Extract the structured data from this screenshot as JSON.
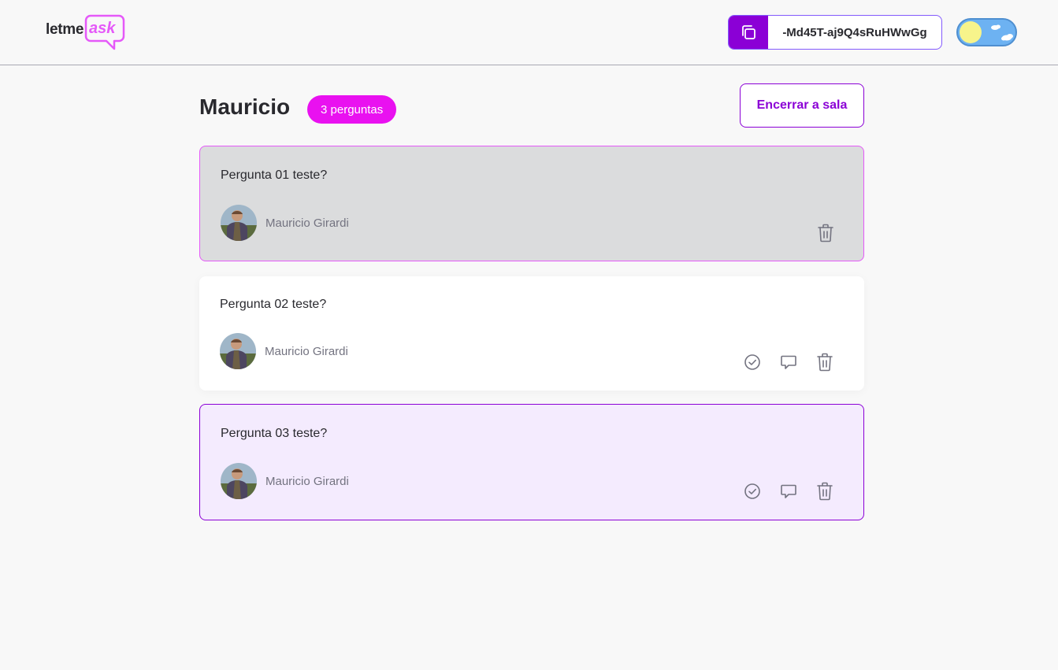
{
  "app": {
    "logo_letme": "letme",
    "logo_ask": "ask"
  },
  "header": {
    "room_code": "-Md45T-aj9Q4sRuHWwGg",
    "copy_icon": "copy-icon",
    "theme_toggle_state": "light"
  },
  "room": {
    "title": "Mauricio",
    "question_count_label": "3 perguntas",
    "end_room_label": "Encerrar a sala"
  },
  "questions": [
    {
      "text": "Pergunta 01 teste?",
      "author": "Mauricio Girardi",
      "state": "highlighted",
      "actions": [
        "trash-icon"
      ]
    },
    {
      "text": "Pergunta 02 teste?",
      "author": "Mauricio Girardi",
      "state": "default",
      "actions": [
        "check-circle-icon",
        "answer-bubble-icon",
        "trash-icon"
      ]
    },
    {
      "text": "Pergunta 03 teste?",
      "author": "Mauricio Girardi",
      "state": "answered-selected",
      "actions": [
        "check-circle-icon",
        "answer-bubble-icon",
        "trash-icon"
      ]
    }
  ],
  "colors": {
    "accent_purple": "#8b00d6",
    "accent_pink": "#e911f0",
    "highlight_bg": "#dbdcdd",
    "selected_bg": "#f4ebfe"
  }
}
